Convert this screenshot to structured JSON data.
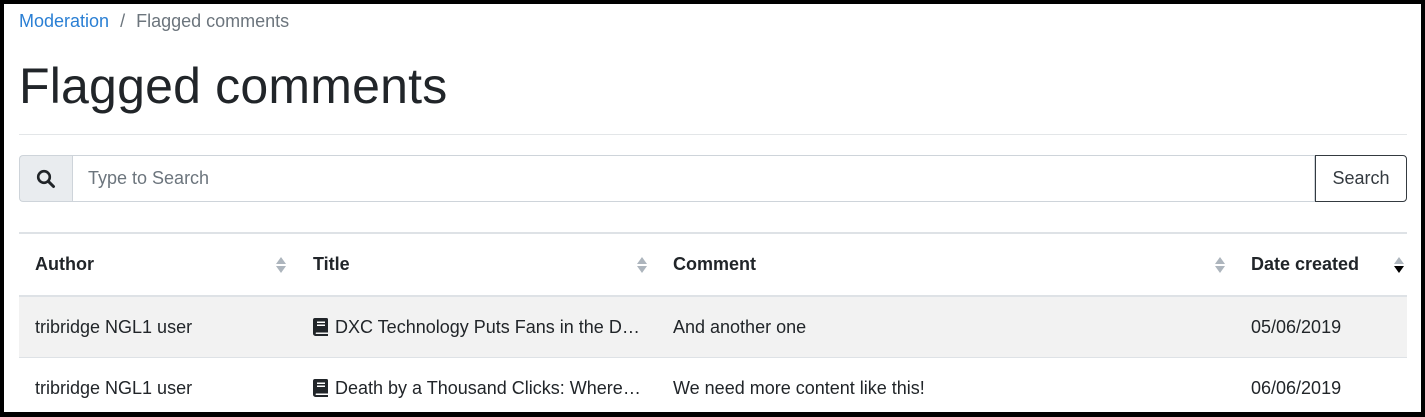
{
  "breadcrumb": {
    "parent_label": "Moderation",
    "separator": "/",
    "current_label": "Flagged comments"
  },
  "page": {
    "title": "Flagged comments"
  },
  "search": {
    "icon": "search-icon",
    "placeholder": "Type to Search",
    "value": "",
    "button_label": "Search"
  },
  "table": {
    "columns": [
      {
        "label": "Author",
        "sort": "none"
      },
      {
        "label": "Title",
        "sort": "none"
      },
      {
        "label": "Comment",
        "sort": "none"
      },
      {
        "label": "Date created",
        "sort": "descending"
      }
    ],
    "rows": [
      {
        "author": "tribridge NGL1 user",
        "title_icon": "book-icon",
        "title": "DXC Technology Puts Fans in the Driver's Seat",
        "comment": "And another one",
        "date_created": "05/06/2019"
      },
      {
        "author": "tribridge NGL1 user",
        "title_icon": "book-icon",
        "title": "Death by a Thousand Clicks: Where Electronic Health Records Went Wrong",
        "comment": "We need more content like this!",
        "date_created": "06/06/2019"
      }
    ]
  },
  "colors": {
    "link": "#2a7fd4",
    "muted": "#6c757d",
    "text": "#212529",
    "stripe": "#f2f2f2"
  }
}
